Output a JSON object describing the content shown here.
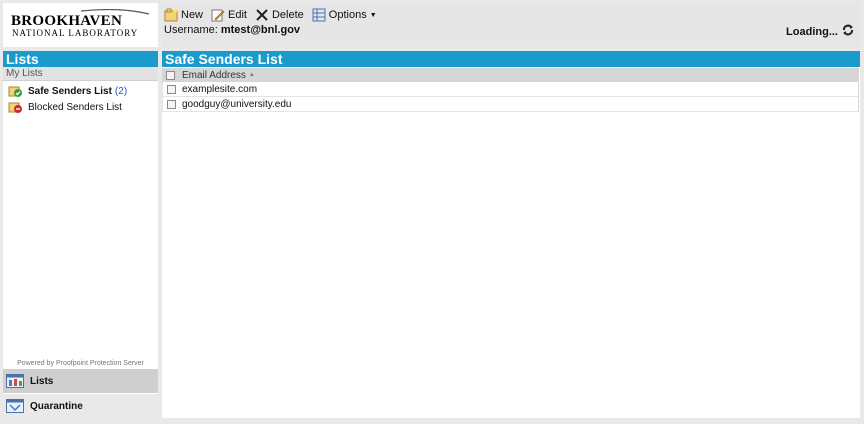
{
  "logo": {
    "line1": "BROOKHAVEN",
    "line2": "NATIONAL LABORATORY"
  },
  "toolbar": {
    "new_label": "New",
    "edit_label": "Edit",
    "delete_label": "Delete",
    "options_label": "Options"
  },
  "user": {
    "prefix": "Username:",
    "name": "mtest@bnl.gov"
  },
  "status": {
    "loading": "Loading..."
  },
  "sidebar": {
    "title": "Lists",
    "subheading": "My Lists",
    "items": [
      {
        "label": "Safe Senders List",
        "count": "(2)"
      },
      {
        "label": "Blocked Senders List"
      }
    ],
    "powered_by": "Powered by Proofpoint Protection Server",
    "nav": [
      {
        "label": "Lists"
      },
      {
        "label": "Quarantine"
      }
    ]
  },
  "main": {
    "title": "Safe Senders List",
    "column_header": "Email Address",
    "rows": [
      "examplesite.com",
      "goodguy@university.edu"
    ]
  },
  "colors": {
    "accent": "#1a9bcb",
    "link": "#2255cc"
  }
}
